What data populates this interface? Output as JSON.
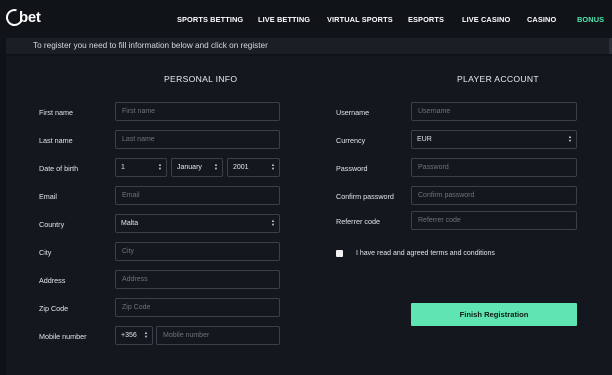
{
  "brand": {
    "logo_text": "bet"
  },
  "nav": {
    "items": [
      {
        "label": "SPORTS BETTING",
        "active": false
      },
      {
        "label": "LIVE BETTING",
        "active": false
      },
      {
        "label": "VIRTUAL SPORTS",
        "active": false
      },
      {
        "label": "ESPORTS",
        "active": false
      },
      {
        "label": "LIVE CASINO",
        "active": false
      },
      {
        "label": "CASINO",
        "active": false
      },
      {
        "label": "BONUS",
        "active": true
      }
    ],
    "active_color": "#4ee8b0"
  },
  "info": {
    "message": "To register you need to fill information below and click on register"
  },
  "personal": {
    "title": "PERSONAL INFO",
    "first_name": {
      "label": "First name",
      "placeholder": "First name",
      "value": ""
    },
    "last_name": {
      "label": "Last name",
      "placeholder": "Last name",
      "value": ""
    },
    "dob": {
      "label": "Date of birth",
      "day": "1",
      "month": "January",
      "year": "2001"
    },
    "email": {
      "label": "Email",
      "placeholder": "Email",
      "value": ""
    },
    "country": {
      "label": "Country",
      "value": "Malta"
    },
    "city": {
      "label": "City",
      "placeholder": "City",
      "value": ""
    },
    "address": {
      "label": "Address",
      "placeholder": "Address",
      "value": ""
    },
    "zip": {
      "label": "Zip Code",
      "placeholder": "Zip Code",
      "value": ""
    },
    "mobile": {
      "label": "Mobile number",
      "prefix": "+356",
      "placeholder": "Mobile number",
      "value": ""
    }
  },
  "account": {
    "title": "PLAYER ACCOUNT",
    "username": {
      "label": "Username",
      "placeholder": "Username",
      "value": ""
    },
    "currency": {
      "label": "Currency",
      "value": "EUR"
    },
    "password": {
      "label": "Password",
      "placeholder": "Password",
      "value": ""
    },
    "confirm_password": {
      "label": "Confirm password",
      "placeholder": "Confirm password",
      "value": ""
    },
    "referrer": {
      "label": "Referrer code",
      "placeholder": "Referrer code",
      "value": ""
    },
    "terms": {
      "label": "I have read and agreed terms and conditions",
      "checked": false
    },
    "submit_label": "Finish Registration"
  },
  "colors": {
    "background": "#0f1217",
    "panel": "#14181e",
    "accent": "#5fe5b2",
    "field_border": "#3a4049"
  }
}
